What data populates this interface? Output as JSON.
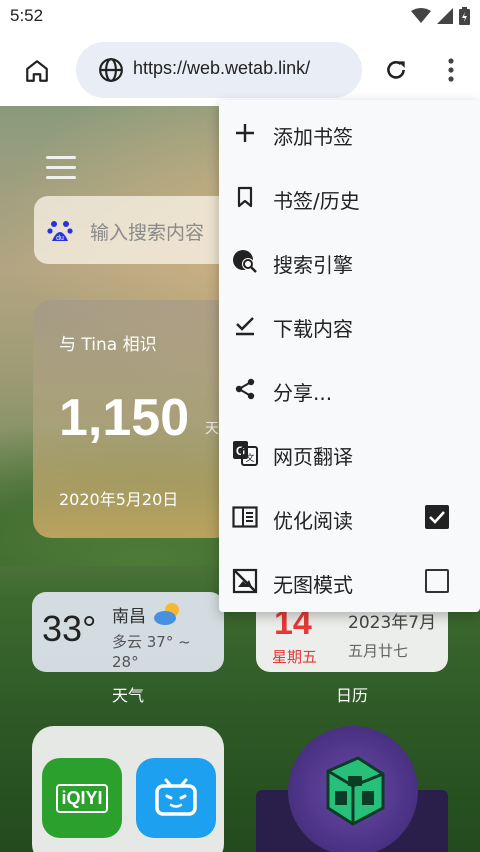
{
  "status": {
    "time": "5:52"
  },
  "toolbar": {
    "url": "https://web.wetab.link/"
  },
  "page": {
    "search_placeholder": "输入搜索内容",
    "countdown": {
      "title": "与 Tina 相识",
      "number": "1,150",
      "unit": "天",
      "date": "2020年5月20日"
    },
    "weather": {
      "temp": "33°",
      "city": "南昌",
      "condition": "多云 37° ~ 28°",
      "label": "天气"
    },
    "calendar": {
      "day": "14",
      "weekday": "星期五",
      "year_month": "2023年7月",
      "lunar": "五月廿七",
      "label": "日历"
    },
    "apps": {
      "iqiyi_text": "iQIYI"
    }
  },
  "menu": {
    "items": [
      {
        "label": "添加书签",
        "icon": "plus-icon"
      },
      {
        "label": "书签/历史",
        "icon": "bookmark-icon"
      },
      {
        "label": "搜索引擎",
        "icon": "search-engine-icon"
      },
      {
        "label": "下载内容",
        "icon": "download-icon"
      },
      {
        "label": "分享...",
        "icon": "share-icon"
      },
      {
        "label": "网页翻译",
        "icon": "translate-icon"
      },
      {
        "label": "优化阅读",
        "icon": "reader-mode-icon",
        "checked": true
      },
      {
        "label": "无图模式",
        "icon": "no-image-icon",
        "checked": false
      }
    ]
  }
}
